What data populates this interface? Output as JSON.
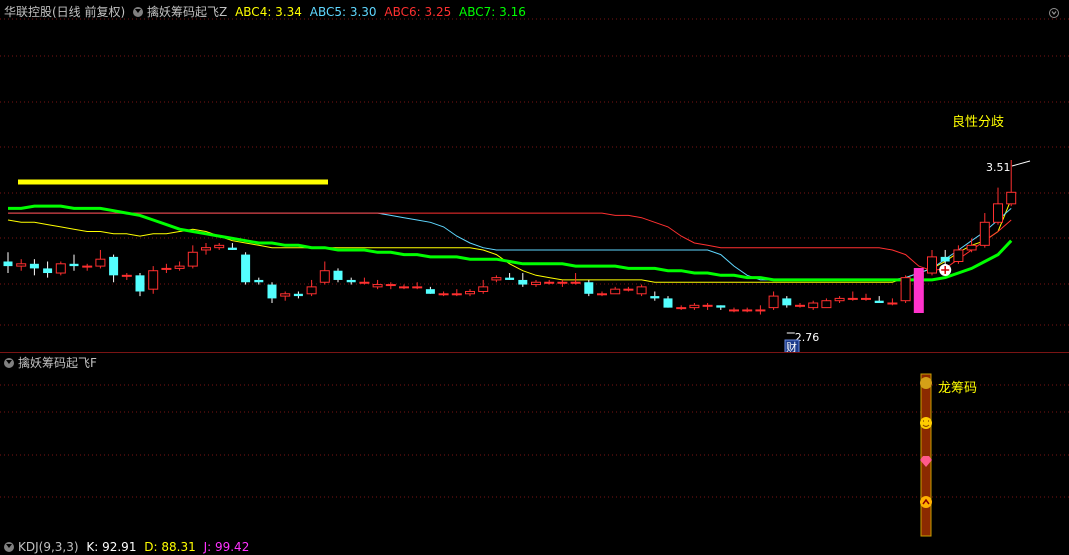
{
  "main_header": {
    "stock": "华联控股(日线 前复权)",
    "indicator": "擒妖筹码起飞Z",
    "abc4": "ABC4: 3.34",
    "abc5": "ABC5: 3.30",
    "abc6": "ABC6: 3.25",
    "abc7": "ABC7: 3.16"
  },
  "colors": {
    "abc4": "#ffff00",
    "abc5": "#5fd7ff",
    "abc6": "#ff3030",
    "abc7": "#00ff00",
    "grid": "#7a1414",
    "up": "#ff3030",
    "down": "#54ffff",
    "magenta": "#ff33cc"
  },
  "annotations": {
    "top_label": "良性分歧",
    "high_price": "3.51",
    "low_price": "2.76",
    "cai_badge": "财",
    "dragon_label": "龙筹码"
  },
  "sub_header": {
    "indicator": "擒妖筹码起飞F"
  },
  "kdj_header": {
    "name": "KDJ(9,3,3)",
    "k": "K: 92.91",
    "d": "D: 88.31",
    "j": "J: 99.42"
  },
  "icons": [
    "chevron-down-icon",
    "maximize-icon",
    "money-bag-icon",
    "smiley-icon",
    "diamond-icon",
    "up-arrow-icon"
  ],
  "chart_data": {
    "type": "candlestick",
    "price_range": [
      2.76,
      3.51
    ],
    "candles": [
      [
        3.07,
        3.11,
        3.02,
        3.05
      ],
      [
        3.05,
        3.08,
        3.03,
        3.06
      ],
      [
        3.06,
        3.08,
        3.01,
        3.04
      ],
      [
        3.04,
        3.07,
        3.0,
        3.02
      ],
      [
        3.02,
        3.07,
        3.01,
        3.06
      ],
      [
        3.06,
        3.1,
        3.03,
        3.05
      ],
      [
        3.05,
        3.06,
        3.03,
        3.05
      ],
      [
        3.05,
        3.12,
        3.04,
        3.08
      ],
      [
        3.09,
        3.1,
        2.98,
        3.01
      ],
      [
        3.01,
        3.02,
        2.99,
        3.01
      ],
      [
        3.01,
        3.02,
        2.92,
        2.94
      ],
      [
        2.95,
        3.05,
        2.93,
        3.03
      ],
      [
        3.04,
        3.06,
        3.02,
        3.04
      ],
      [
        3.04,
        3.07,
        3.03,
        3.05
      ],
      [
        3.05,
        3.14,
        3.04,
        3.11
      ],
      [
        3.12,
        3.15,
        3.1,
        3.13
      ],
      [
        3.13,
        3.15,
        3.12,
        3.14
      ],
      [
        3.13,
        3.15,
        3.12,
        3.12
      ],
      [
        3.1,
        3.11,
        2.97,
        2.98
      ],
      [
        2.99,
        3.0,
        2.97,
        2.98
      ],
      [
        2.97,
        2.98,
        2.89,
        2.91
      ],
      [
        2.92,
        2.94,
        2.9,
        2.93
      ],
      [
        2.93,
        2.94,
        2.91,
        2.92
      ],
      [
        2.93,
        2.99,
        2.92,
        2.96
      ],
      [
        2.98,
        3.07,
        2.97,
        3.03
      ],
      [
        3.03,
        3.04,
        2.98,
        2.99
      ],
      [
        2.99,
        3.0,
        2.97,
        2.98
      ],
      [
        2.98,
        3.0,
        2.97,
        2.98
      ],
      [
        2.96,
        2.99,
        2.95,
        2.97
      ],
      [
        2.97,
        2.98,
        2.95,
        2.97
      ],
      [
        2.96,
        2.97,
        2.95,
        2.96
      ],
      [
        2.96,
        2.98,
        2.95,
        2.96
      ],
      [
        2.95,
        2.96,
        2.93,
        2.93
      ],
      [
        2.93,
        2.94,
        2.92,
        2.93
      ],
      [
        2.93,
        2.95,
        2.92,
        2.93
      ],
      [
        2.93,
        2.95,
        2.92,
        2.94
      ],
      [
        2.94,
        2.99,
        2.93,
        2.96
      ],
      [
        2.99,
        3.01,
        2.98,
        3.0
      ],
      [
        3.0,
        3.02,
        2.99,
        2.99
      ],
      [
        2.99,
        3.02,
        2.96,
        2.97
      ],
      [
        2.97,
        2.99,
        2.96,
        2.98
      ],
      [
        2.98,
        2.99,
        2.97,
        2.98
      ],
      [
        2.98,
        2.99,
        2.96,
        2.98
      ],
      [
        2.98,
        3.02,
        2.97,
        2.98
      ],
      [
        2.98,
        2.99,
        2.92,
        2.93
      ],
      [
        2.93,
        2.94,
        2.92,
        2.93
      ],
      [
        2.93,
        2.96,
        2.93,
        2.95
      ],
      [
        2.95,
        2.96,
        2.94,
        2.95
      ],
      [
        2.93,
        2.97,
        2.92,
        2.96
      ],
      [
        2.92,
        2.94,
        2.9,
        2.91
      ],
      [
        2.91,
        2.92,
        2.87,
        2.87
      ],
      [
        2.87,
        2.88,
        2.86,
        2.87
      ],
      [
        2.87,
        2.89,
        2.86,
        2.88
      ],
      [
        2.88,
        2.89,
        2.86,
        2.88
      ],
      [
        2.88,
        2.88,
        2.86,
        2.87
      ],
      [
        2.86,
        2.87,
        2.85,
        2.86
      ],
      [
        2.86,
        2.87,
        2.85,
        2.86
      ],
      [
        2.86,
        2.88,
        2.84,
        2.86
      ],
      [
        2.87,
        2.94,
        2.86,
        2.92
      ],
      [
        2.91,
        2.92,
        2.87,
        2.88
      ],
      [
        2.88,
        2.89,
        2.87,
        2.88
      ],
      [
        2.87,
        2.9,
        2.86,
        2.89
      ],
      [
        2.87,
        2.91,
        2.87,
        2.9
      ],
      [
        2.9,
        2.92,
        2.89,
        2.91
      ],
      [
        2.91,
        2.94,
        2.9,
        2.91
      ],
      [
        2.91,
        2.93,
        2.9,
        2.91
      ],
      [
        2.9,
        2.92,
        2.89,
        2.89
      ],
      [
        2.89,
        2.91,
        2.88,
        2.89
      ],
      [
        2.9,
        3.01,
        2.89,
        3.0
      ],
      [
        3.0,
        3.03,
        2.99,
        3.02
      ],
      [
        3.02,
        3.12,
        3.01,
        3.09
      ],
      [
        3.09,
        3.12,
        3.05,
        3.07
      ],
      [
        3.07,
        3.14,
        3.06,
        3.12
      ],
      [
        3.12,
        3.17,
        3.11,
        3.14
      ],
      [
        3.14,
        3.28,
        3.13,
        3.24
      ],
      [
        3.24,
        3.39,
        3.23,
        3.32
      ],
      [
        3.32,
        3.51,
        3.31,
        3.37
      ]
    ],
    "series": [
      {
        "name": "ABC4",
        "values": [
          3.25,
          3.24,
          3.24,
          3.23,
          3.22,
          3.21,
          3.2,
          3.2,
          3.19,
          3.19,
          3.18,
          3.19,
          3.19,
          3.2,
          3.21,
          3.2,
          3.18,
          3.16,
          3.15,
          3.14,
          3.13,
          3.13,
          3.13,
          3.13,
          3.13,
          3.13,
          3.13,
          3.13,
          3.13,
          3.13,
          3.13,
          3.13,
          3.13,
          3.13,
          3.13,
          3.13,
          3.12,
          3.1,
          3.06,
          3.03,
          3.01,
          3.0,
          2.99,
          2.99,
          2.99,
          2.99,
          2.99,
          2.99,
          2.99,
          2.98,
          2.98,
          2.98,
          2.98,
          2.98,
          2.98,
          2.98,
          2.98,
          2.98,
          2.98,
          2.98,
          2.98,
          2.98,
          2.98,
          2.98,
          2.98,
          2.98,
          2.98,
          2.98,
          3.0,
          3.02,
          3.04,
          3.07,
          3.11,
          3.14,
          3.16,
          3.2,
          3.34
        ]
      },
      {
        "name": "ABC5",
        "values": [
          3.28,
          3.28,
          3.28,
          3.28,
          3.28,
          3.28,
          3.28,
          3.28,
          3.28,
          3.28,
          3.28,
          3.28,
          3.28,
          3.28,
          3.28,
          3.28,
          3.28,
          3.28,
          3.28,
          3.28,
          3.28,
          3.28,
          3.28,
          3.28,
          3.28,
          3.28,
          3.28,
          3.28,
          3.28,
          3.27,
          3.26,
          3.25,
          3.24,
          3.22,
          3.18,
          3.15,
          3.13,
          3.12,
          3.12,
          3.12,
          3.12,
          3.12,
          3.12,
          3.12,
          3.12,
          3.12,
          3.12,
          3.12,
          3.12,
          3.12,
          3.12,
          3.12,
          3.12,
          3.12,
          3.1,
          3.05,
          3.01,
          2.99,
          2.99,
          2.99,
          2.99,
          2.99,
          2.99,
          2.99,
          2.99,
          2.99,
          2.99,
          2.99,
          3.0,
          3.02,
          3.04,
          3.08,
          3.12,
          3.16,
          3.2,
          3.25,
          3.3
        ]
      },
      {
        "name": "ABC6",
        "values": [
          3.28,
          3.28,
          3.28,
          3.28,
          3.28,
          3.28,
          3.28,
          3.28,
          3.28,
          3.28,
          3.28,
          3.28,
          3.28,
          3.28,
          3.28,
          3.28,
          3.28,
          3.28,
          3.28,
          3.28,
          3.28,
          3.28,
          3.28,
          3.28,
          3.28,
          3.28,
          3.28,
          3.28,
          3.28,
          3.28,
          3.28,
          3.28,
          3.28,
          3.28,
          3.28,
          3.28,
          3.28,
          3.28,
          3.28,
          3.28,
          3.28,
          3.28,
          3.28,
          3.28,
          3.28,
          3.28,
          3.27,
          3.27,
          3.26,
          3.24,
          3.22,
          3.18,
          3.15,
          3.14,
          3.13,
          3.13,
          3.13,
          3.13,
          3.13,
          3.13,
          3.13,
          3.13,
          3.13,
          3.13,
          3.13,
          3.13,
          3.13,
          3.12,
          3.1,
          3.05,
          3.03,
          3.04,
          3.08,
          3.12,
          3.16,
          3.2,
          3.25
        ]
      },
      {
        "name": "ABC7",
        "values": [
          3.3,
          3.3,
          3.31,
          3.31,
          3.31,
          3.3,
          3.3,
          3.3,
          3.29,
          3.28,
          3.27,
          3.25,
          3.23,
          3.21,
          3.2,
          3.19,
          3.18,
          3.17,
          3.16,
          3.15,
          3.15,
          3.14,
          3.14,
          3.13,
          3.13,
          3.12,
          3.12,
          3.12,
          3.11,
          3.11,
          3.1,
          3.1,
          3.09,
          3.09,
          3.09,
          3.08,
          3.08,
          3.08,
          3.07,
          3.06,
          3.06,
          3.06,
          3.06,
          3.05,
          3.05,
          3.05,
          3.05,
          3.04,
          3.04,
          3.04,
          3.03,
          3.03,
          3.02,
          3.02,
          3.01,
          3.01,
          3.0,
          3.0,
          2.99,
          2.99,
          2.99,
          2.99,
          2.99,
          2.99,
          2.99,
          2.99,
          2.99,
          2.99,
          2.99,
          2.99,
          2.99,
          3.0,
          3.02,
          3.04,
          3.07,
          3.1,
          3.16
        ]
      }
    ]
  }
}
